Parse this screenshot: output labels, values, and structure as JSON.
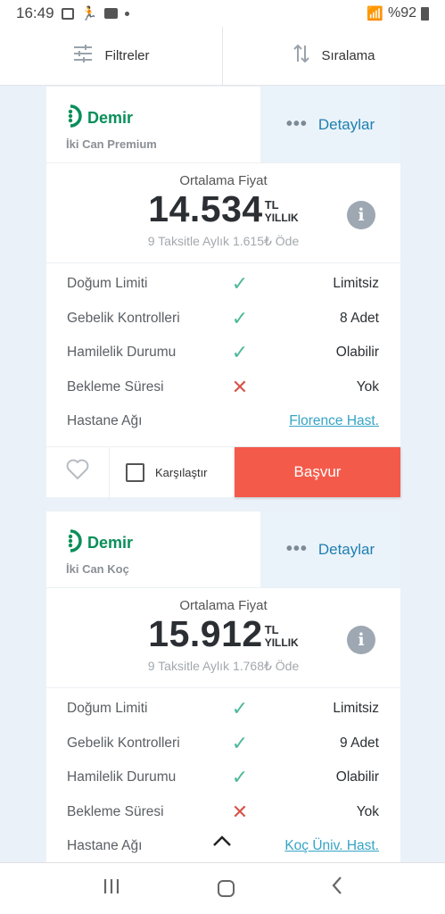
{
  "status_bar": {
    "time": "16:49",
    "battery": "%92"
  },
  "toolbar": {
    "filter_label": "Filtreler",
    "sort_label": "Sıralama"
  },
  "plans": [
    {
      "brand": "Demir",
      "plan_name": "İki Can Premium",
      "details_label": "Detaylar",
      "price_label": "Ortalama Fiyat",
      "price": "14.534",
      "currency": "TL",
      "period": "YILLIK",
      "installment": "9 Taksitle Aylık 1.615₺ Öde",
      "features": [
        {
          "label": "Doğum Limiti",
          "status": "check",
          "value": "Limitsiz"
        },
        {
          "label": "Gebelik Kontrolleri",
          "status": "check",
          "value": "8 Adet"
        },
        {
          "label": "Hamilelik Durumu",
          "status": "check",
          "value": "Olabilir"
        },
        {
          "label": "Bekleme Süresi",
          "status": "cross",
          "value": "Yok"
        }
      ],
      "hospital_label": "Hastane Ağı",
      "hospital_link": "Florence Hast.",
      "compare_label": "Karşılaştır",
      "apply_label": "Başvur"
    },
    {
      "brand": "Demir",
      "plan_name": "İki Can Koç",
      "details_label": "Detaylar",
      "price_label": "Ortalama Fiyat",
      "price": "15.912",
      "currency": "TL",
      "period": "YILLIK",
      "installment": "9 Taksitle Aylık 1.768₺ Öde",
      "features": [
        {
          "label": "Doğum Limiti",
          "status": "check",
          "value": "Limitsiz"
        },
        {
          "label": "Gebelik Kontrolleri",
          "status": "check",
          "value": "9 Adet"
        },
        {
          "label": "Hamilelik Durumu",
          "status": "check",
          "value": "Olabilir"
        },
        {
          "label": "Bekleme Süresi",
          "status": "cross",
          "value": "Yok"
        }
      ],
      "hospital_label": "Hastane Ağı",
      "hospital_link": "Koç Üniv. Hast."
    }
  ],
  "colors": {
    "brand_green": "#0a8f5a",
    "apply_red": "#f45a4a",
    "link_blue": "#35a4c6",
    "check_green": "#4db89a",
    "cross_red": "#d8534a"
  }
}
